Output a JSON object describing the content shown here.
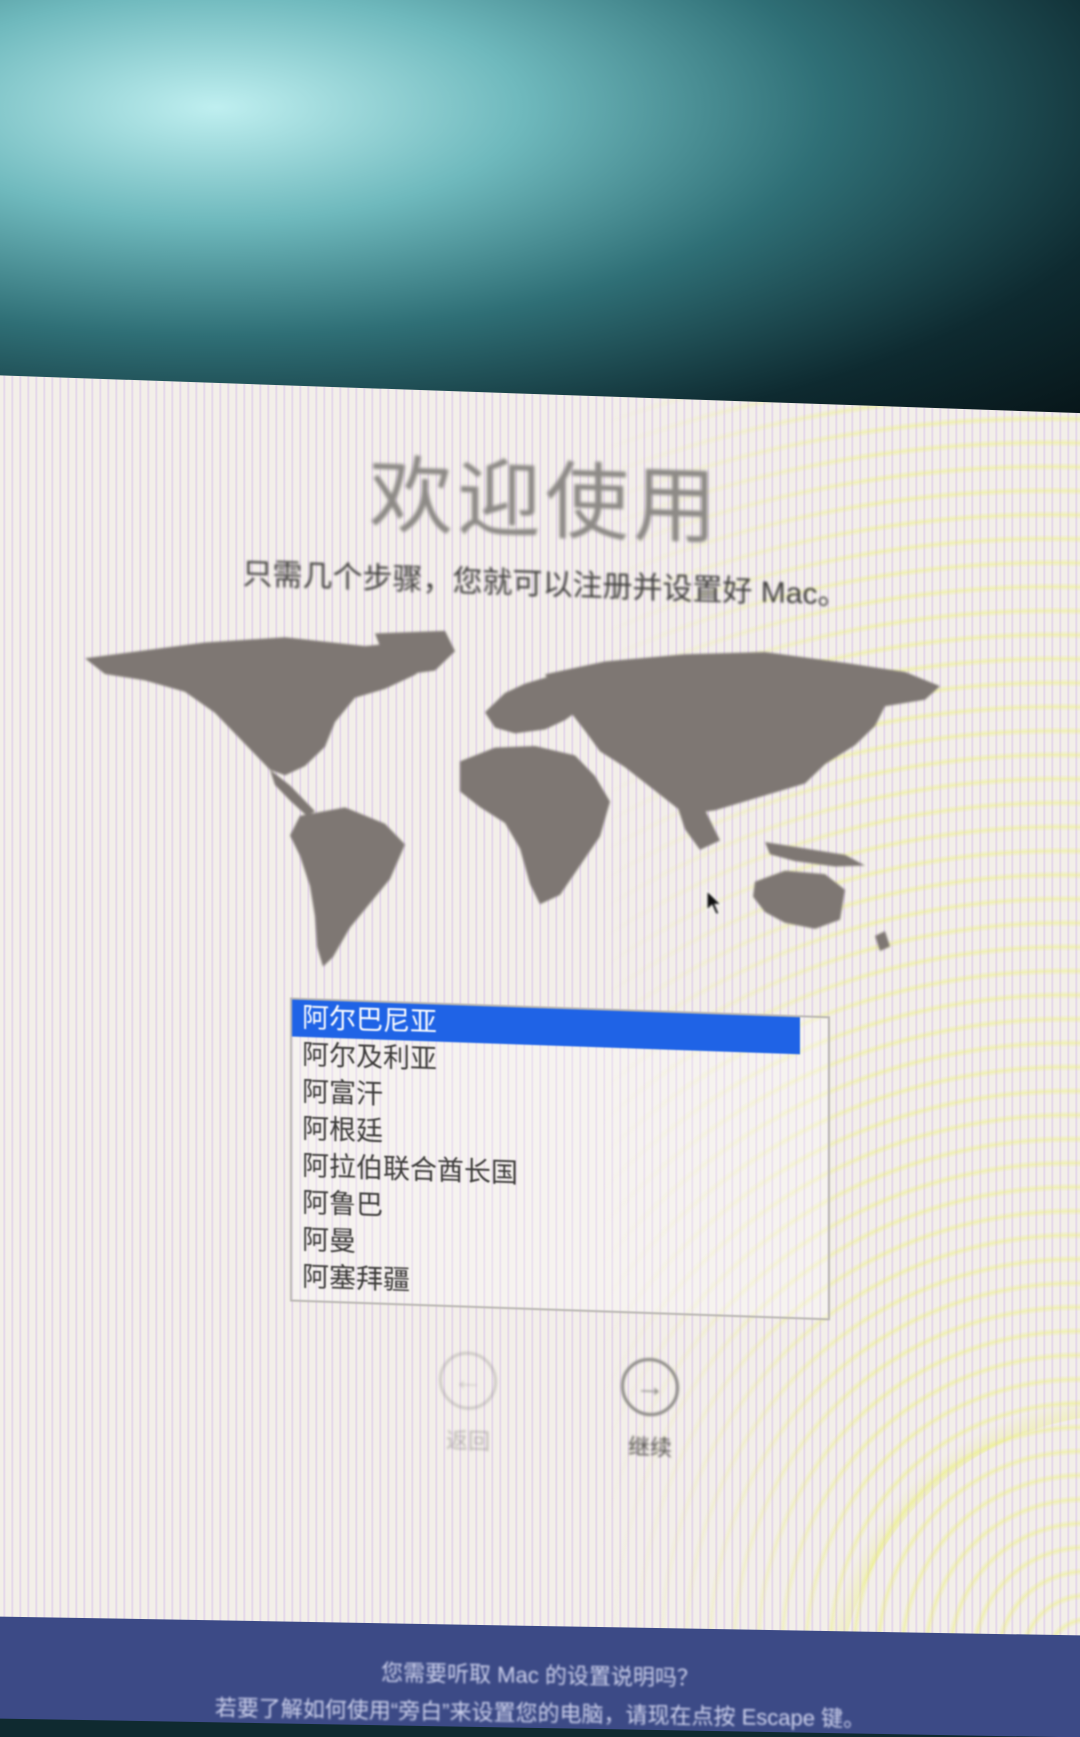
{
  "window": {
    "title": "欢迎使用",
    "subtitle": "只需几个步骤，您就可以注册并设置好 Mac。"
  },
  "country_list": {
    "items": [
      {
        "label": "阿尔巴尼亚",
        "selected": true
      },
      {
        "label": "阿尔及利亚",
        "selected": false
      },
      {
        "label": "阿富汗",
        "selected": false
      },
      {
        "label": "阿根廷",
        "selected": false
      },
      {
        "label": "阿拉伯联合酋长国",
        "selected": false
      },
      {
        "label": "阿鲁巴",
        "selected": false
      },
      {
        "label": "阿曼",
        "selected": false
      },
      {
        "label": "阿塞拜疆",
        "selected": false
      }
    ]
  },
  "navigation": {
    "back_label": "返回",
    "continue_label": "继续",
    "back_icon": "arrow-left-icon",
    "continue_icon": "arrow-right-icon"
  },
  "footer": {
    "line1": "您需要听取 Mac 的设置说明吗？",
    "line2": "若要了解如何使用“旁白”来设置您的电脑，请现在点按 Escape 键。"
  },
  "colors": {
    "selection": "#1f63e6",
    "map": "#7e7773",
    "footer_bg": "#3c4a86"
  }
}
